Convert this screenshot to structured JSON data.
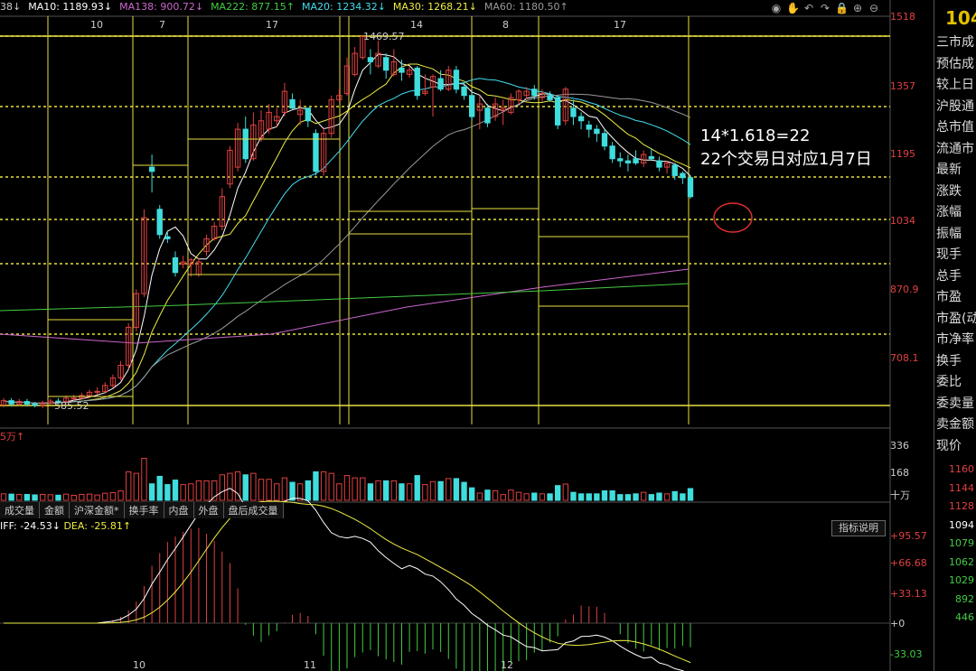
{
  "ma_legend": [
    {
      "text": "38↓",
      "color": "#cccccc"
    },
    {
      "text": "MA10: 1189.93↓",
      "color": "#ffffff"
    },
    {
      "text": "MA138: 900.72↓",
      "color": "#cc66cc"
    },
    {
      "text": "MA222: 877.15↑",
      "color": "#44cc44"
    },
    {
      "text": "MA20: 1234.32↓",
      "color": "#44ddee"
    },
    {
      "text": "MA30: 1268.21↓",
      "color": "#eeee44"
    },
    {
      "text": "MA60: 1180.50↑",
      "color": "#999999"
    }
  ],
  "toolbar_icons": [
    "eye-icon",
    "hand-icon",
    "undo-icon",
    "redo-icon",
    "lock-icon",
    "zoom-in-icon",
    "zoom-out-icon"
  ],
  "toolbar_glyphs": [
    "◉",
    "✋",
    "↶",
    "↷",
    "🔒",
    "⊕",
    "⊖"
  ],
  "price_axis": [
    "1518",
    "1357",
    "1195",
    "1034",
    "870.9",
    "708.1"
  ],
  "top_ticks": [
    "10",
    "7",
    "17",
    "14",
    "8",
    "17"
  ],
  "bottom_ticks": [
    "10",
    "11",
    "12"
  ],
  "price_labels": {
    "high": "1469.57",
    "low": "585.52"
  },
  "volume": {
    "unit": "5万↑",
    "axis": [
      "336",
      "168"
    ],
    "unit_label": "十万"
  },
  "volume_tabs": [
    "成交量",
    "金额",
    "沪深金额*",
    "换手率",
    "内盘",
    "外盘",
    "盘后成交量"
  ],
  "macd": {
    "legend": [
      {
        "text": "IFF: -24.53↓",
        "color": "#ffffff"
      },
      {
        "text": "DEA: -25.81↑",
        "color": "#eeee44"
      }
    ],
    "axis": [
      "+95.57",
      "+66.68",
      "+33.13",
      "+0",
      "-33.03"
    ],
    "button": "指标说明"
  },
  "annotation": {
    "line1": "14*1.618=22",
    "line2": "22个交易日对应1月7日"
  },
  "sidebar": {
    "top_value": "104",
    "labels": [
      "三市成",
      "预估成",
      "较上日",
      "沪股通",
      "总市值",
      "流通市",
      "最新",
      "涨跌",
      "涨幅",
      "振幅",
      "现手",
      "总手",
      "市盈",
      "市盈(动",
      "市净率",
      "换手",
      "委比",
      "委卖量",
      "卖金额",
      "现价"
    ],
    "prices": [
      {
        "text": "1160",
        "color": "#e04040"
      },
      {
        "text": "1144",
        "color": "#e04040"
      },
      {
        "text": "1128",
        "color": "#e04040"
      },
      {
        "text": "1094",
        "color": "#ffffff"
      },
      {
        "text": "1079",
        "color": "#44cc44"
      },
      {
        "text": "1062",
        "color": "#44cc44"
      },
      {
        "text": "1029",
        "color": "#44cc44"
      },
      {
        "text": "892",
        "color": "#44cc44"
      },
      {
        "text": "446",
        "color": "#44cc44"
      }
    ]
  },
  "chart_data": {
    "type": "candlestick",
    "price_axis": [
      "1518",
      "1357",
      "1195",
      "1034",
      "870.9",
      "708.1"
    ],
    "candles": [
      {
        "o": 596,
        "c": 606,
        "h": 612,
        "l": 590
      },
      {
        "o": 606,
        "c": 598,
        "h": 612,
        "l": 592
      },
      {
        "o": 598,
        "c": 604,
        "h": 610,
        "l": 594
      },
      {
        "o": 604,
        "c": 598,
        "h": 610,
        "l": 592
      },
      {
        "o": 598,
        "c": 595,
        "h": 603,
        "l": 590
      },
      {
        "o": 595,
        "c": 601,
        "h": 606,
        "l": 588
      },
      {
        "o": 601,
        "c": 605,
        "h": 611,
        "l": 596
      },
      {
        "o": 605,
        "c": 604,
        "h": 612,
        "l": 598
      },
      {
        "o": 604,
        "c": 612,
        "h": 618,
        "l": 598
      },
      {
        "o": 612,
        "c": 612,
        "h": 620,
        "l": 605
      },
      {
        "o": 612,
        "c": 618,
        "h": 625,
        "l": 608
      },
      {
        "o": 618,
        "c": 626,
        "h": 632,
        "l": 612
      },
      {
        "o": 626,
        "c": 628,
        "h": 638,
        "l": 620
      },
      {
        "o": 628,
        "c": 642,
        "h": 650,
        "l": 622
      },
      {
        "o": 642,
        "c": 660,
        "h": 668,
        "l": 636
      },
      {
        "o": 660,
        "c": 690,
        "h": 700,
        "l": 654
      },
      {
        "o": 690,
        "c": 780,
        "h": 790,
        "l": 680
      },
      {
        "o": 780,
        "c": 860,
        "h": 870,
        "l": 770
      },
      {
        "o": 860,
        "c": 1040,
        "h": 1060,
        "l": 852
      },
      {
        "o": 1160,
        "c": 1150,
        "h": 1190,
        "l": 1100
      },
      {
        "o": 1060,
        "c": 1000,
        "h": 1070,
        "l": 990
      },
      {
        "o": 995,
        "c": 990,
        "h": 1008,
        "l": 980
      },
      {
        "o": 945,
        "c": 910,
        "h": 960,
        "l": 900
      },
      {
        "o": 930,
        "c": 935,
        "h": 950,
        "l": 920
      },
      {
        "o": 930,
        "c": 940,
        "h": 945,
        "l": 900
      },
      {
        "o": 905,
        "c": 935,
        "h": 945,
        "l": 900
      },
      {
        "o": 960,
        "c": 990,
        "h": 1000,
        "l": 950
      },
      {
        "o": 990,
        "c": 1020,
        "h": 1030,
        "l": 985
      },
      {
        "o": 1020,
        "c": 1090,
        "h": 1110,
        "l": 1010
      },
      {
        "o": 1120,
        "c": 1200,
        "h": 1210,
        "l": 1110
      },
      {
        "o": 1160,
        "c": 1250,
        "h": 1265,
        "l": 1150
      },
      {
        "o": 1250,
        "c": 1180,
        "h": 1280,
        "l": 1170
      },
      {
        "o": 1180,
        "c": 1260,
        "h": 1290,
        "l": 1175
      },
      {
        "o": 1230,
        "c": 1270,
        "h": 1295,
        "l": 1220
      },
      {
        "o": 1250,
        "c": 1290,
        "h": 1310,
        "l": 1240
      },
      {
        "o": 1270,
        "c": 1280,
        "h": 1300,
        "l": 1255
      },
      {
        "o": 1290,
        "c": 1340,
        "h": 1360,
        "l": 1280
      },
      {
        "o": 1320,
        "c": 1300,
        "h": 1335,
        "l": 1295
      },
      {
        "o": 1285,
        "c": 1295,
        "h": 1320,
        "l": 1260
      },
      {
        "o": 1300,
        "c": 1270,
        "h": 1300,
        "l": 1255
      },
      {
        "o": 1240,
        "c": 1150,
        "h": 1250,
        "l": 1140
      },
      {
        "o": 1150,
        "c": 1240,
        "h": 1255,
        "l": 1140
      },
      {
        "o": 1240,
        "c": 1320,
        "h": 1330,
        "l": 1230
      },
      {
        "o": 1320,
        "c": 1330,
        "h": 1345,
        "l": 1315
      },
      {
        "o": 1335,
        "c": 1400,
        "h": 1420,
        "l": 1330
      },
      {
        "o": 1380,
        "c": 1430,
        "h": 1445,
        "l": 1375
      },
      {
        "o": 1420,
        "c": 1470,
        "h": 1470,
        "l": 1415
      },
      {
        "o": 1420,
        "c": 1410,
        "h": 1440,
        "l": 1380
      },
      {
        "o": 1400,
        "c": 1430,
        "h": 1460,
        "l": 1395
      },
      {
        "o": 1420,
        "c": 1390,
        "h": 1430,
        "l": 1370
      },
      {
        "o": 1380,
        "c": 1410,
        "h": 1440,
        "l": 1375
      },
      {
        "o": 1395,
        "c": 1385,
        "h": 1415,
        "l": 1365
      },
      {
        "o": 1380,
        "c": 1390,
        "h": 1400,
        "l": 1372
      },
      {
        "o": 1395,
        "c": 1330,
        "h": 1400,
        "l": 1320
      },
      {
        "o": 1335,
        "c": 1340,
        "h": 1380,
        "l": 1330
      },
      {
        "o": 1350,
        "c": 1375,
        "h": 1380,
        "l": 1280
      },
      {
        "o": 1370,
        "c": 1345,
        "h": 1390,
        "l": 1340
      },
      {
        "o": 1345,
        "c": 1390,
        "h": 1400,
        "l": 1340
      },
      {
        "o": 1390,
        "c": 1345,
        "h": 1400,
        "l": 1335
      },
      {
        "o": 1350,
        "c": 1330,
        "h": 1360,
        "l": 1320
      },
      {
        "o": 1330,
        "c": 1280,
        "h": 1340,
        "l": 1270
      },
      {
        "o": 1295,
        "c": 1310,
        "h": 1330,
        "l": 1250
      },
      {
        "o": 1300,
        "c": 1265,
        "h": 1310,
        "l": 1255
      },
      {
        "o": 1280,
        "c": 1310,
        "h": 1325,
        "l": 1270
      },
      {
        "o": 1295,
        "c": 1300,
        "h": 1320,
        "l": 1260
      },
      {
        "o": 1290,
        "c": 1325,
        "h": 1335,
        "l": 1285
      },
      {
        "o": 1320,
        "c": 1340,
        "h": 1345,
        "l": 1310
      },
      {
        "o": 1330,
        "c": 1340,
        "h": 1350,
        "l": 1320
      },
      {
        "o": 1345,
        "c": 1330,
        "h": 1355,
        "l": 1320
      },
      {
        "o": 1325,
        "c": 1335,
        "h": 1345,
        "l": 1315
      },
      {
        "o": 1330,
        "c": 1320,
        "h": 1340,
        "l": 1315
      },
      {
        "o": 1325,
        "c": 1260,
        "h": 1330,
        "l": 1250
      },
      {
        "o": 1270,
        "c": 1345,
        "h": 1350,
        "l": 1260
      },
      {
        "o": 1300,
        "c": 1280,
        "h": 1320,
        "l": 1260
      },
      {
        "o": 1280,
        "c": 1270,
        "h": 1290,
        "l": 1250
      },
      {
        "o": 1260,
        "c": 1250,
        "h": 1270,
        "l": 1230
      },
      {
        "o": 1250,
        "c": 1240,
        "h": 1260,
        "l": 1220
      },
      {
        "o": 1240,
        "c": 1210,
        "h": 1250,
        "l": 1200
      },
      {
        "o": 1210,
        "c": 1180,
        "h": 1220,
        "l": 1170
      },
      {
        "o": 1180,
        "c": 1175,
        "h": 1195,
        "l": 1160
      },
      {
        "o": 1175,
        "c": 1170,
        "h": 1190,
        "l": 1150
      },
      {
        "o": 1180,
        "c": 1170,
        "h": 1200,
        "l": 1165
      },
      {
        "o": 1170,
        "c": 1190,
        "h": 1200,
        "l": 1160
      },
      {
        "o": 1185,
        "c": 1180,
        "h": 1205,
        "l": 1175
      },
      {
        "o": 1175,
        "c": 1160,
        "h": 1185,
        "l": 1150
      },
      {
        "o": 1160,
        "c": 1170,
        "h": 1175,
        "l": 1145
      },
      {
        "o": 1165,
        "c": 1140,
        "h": 1170,
        "l": 1130
      },
      {
        "o": 1145,
        "c": 1135,
        "h": 1150,
        "l": 1120
      },
      {
        "o": 1135,
        "c": 1090,
        "h": 1140,
        "l": 1085
      }
    ],
    "volume_range": [
      0,
      336
    ],
    "macd_range": [
      -33.03,
      95.57
    ]
  }
}
